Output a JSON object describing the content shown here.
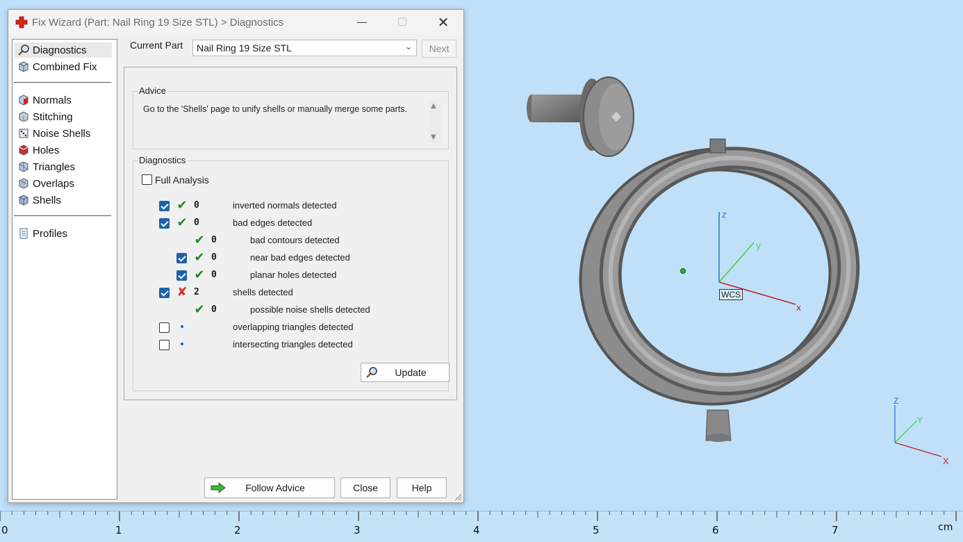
{
  "dialog": {
    "title": "Fix Wizard (Part: Nail Ring 19 Size STL) > Diagnostics",
    "window_buttons": {
      "minimize": "—",
      "maximize": "☐",
      "close": "✕"
    }
  },
  "sidebar": {
    "items": [
      {
        "label": "Diagnostics",
        "icon": "magnifier-icon",
        "selected": true
      },
      {
        "label": "Combined Fix",
        "icon": "cube-icon"
      },
      {
        "label": "Normals",
        "icon": "cube-red-face-icon"
      },
      {
        "label": "Stitching",
        "icon": "cube-stitch-icon"
      },
      {
        "label": "Noise Shells",
        "icon": "dice-icon"
      },
      {
        "label": "Holes",
        "icon": "cube-red-icon"
      },
      {
        "label": "Triangles",
        "icon": "triangle-cube-icon"
      },
      {
        "label": "Overlaps",
        "icon": "cube-overlap-icon"
      },
      {
        "label": "Shells",
        "icon": "cube-shell-icon"
      },
      {
        "label": "Profiles",
        "icon": "document-icon"
      }
    ]
  },
  "current_part": {
    "label": "Current Part",
    "value": "Nail Ring 19 Size STL"
  },
  "next_label": "Next",
  "advice": {
    "heading": "Advice",
    "text": "Go to the 'Shells' page to unify shells or manually merge some parts."
  },
  "diagnostics": {
    "heading": "Diagnostics",
    "full_analysis_label": "Full Analysis",
    "full_analysis_checked": false,
    "rows": [
      {
        "checkbox": true,
        "checked": true,
        "status": "ok",
        "count": "0",
        "label": "inverted normals detected",
        "indent": 0
      },
      {
        "checkbox": true,
        "checked": true,
        "status": "ok",
        "count": "0",
        "label": "bad edges detected",
        "indent": 0
      },
      {
        "checkbox": false,
        "checked": false,
        "status": "ok",
        "count": "0",
        "label": "bad contours detected",
        "indent": 1
      },
      {
        "checkbox": true,
        "checked": true,
        "status": "ok",
        "count": "0",
        "label": "near bad edges detected",
        "indent": 1
      },
      {
        "checkbox": true,
        "checked": true,
        "status": "ok",
        "count": "0",
        "label": "planar holes detected",
        "indent": 1
      },
      {
        "checkbox": true,
        "checked": true,
        "status": "bad",
        "count": "2",
        "label": "shells detected",
        "indent": 0
      },
      {
        "checkbox": false,
        "checked": false,
        "status": "ok",
        "count": "0",
        "label": "possible noise shells detected",
        "indent": 1
      },
      {
        "checkbox": true,
        "checked": false,
        "status": "dot",
        "count": "",
        "label": "overlapping triangles detected",
        "indent": 0
      },
      {
        "checkbox": true,
        "checked": false,
        "status": "dot",
        "count": "",
        "label": "intersecting triangles detected",
        "indent": 0
      }
    ],
    "update_label": "Update"
  },
  "footer": {
    "follow_advice": "Follow Advice",
    "close": "Close",
    "help": "Help"
  },
  "viewport": {
    "wcs_label": "WCS",
    "axis_x": "x",
    "axis_y": "y",
    "axis_z": "z",
    "corner_x": "X",
    "corner_y": "Y",
    "corner_z": "Z"
  },
  "ruler": {
    "labels": [
      "0",
      "1",
      "2",
      "3",
      "4",
      "5",
      "6",
      "7"
    ],
    "unit": "cm"
  },
  "colors": {
    "viewport_bg": "#bfe0f8",
    "ok": "#1f8a24",
    "bad": "#d0331f",
    "accent": "#1c62a8"
  }
}
